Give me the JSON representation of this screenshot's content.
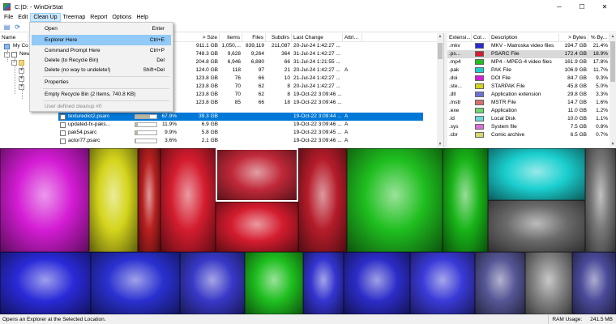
{
  "window": {
    "title": "C:|D: - WinDirStat",
    "minimize": "─",
    "maximize": "☐",
    "close": "✕"
  },
  "menubar": [
    "File",
    "Edit",
    "Clean Up",
    "Treemap",
    "Report",
    "Options",
    "Help"
  ],
  "toolbar": {
    "buttons": [
      "open-icon",
      "refresh-icon"
    ]
  },
  "cleanup_menu": {
    "items": [
      {
        "label": "Open",
        "shortcut": "Enter"
      },
      {
        "label": "Explorer Here",
        "shortcut": "Ctrl+E"
      },
      {
        "label": "Command Prompt Here",
        "shortcut": "Ctrl+P"
      },
      {
        "label": "Delete (to Recycle Bin)",
        "shortcut": "Del"
      },
      {
        "label": "Delete (no way to undelete!)",
        "shortcut": "Shift+Del"
      },
      {
        "label": "Properties",
        "shortcut": ""
      },
      {
        "label": "Empty Recycle Bin (2 Items, 740.8 KB)",
        "shortcut": ""
      },
      {
        "label": "User defined cleanup #0",
        "shortcut": ""
      }
    ]
  },
  "directory_list": {
    "columns": {
      "name": "Name",
      "size": "> Size",
      "items": "Items",
      "files": "Files",
      "subdirs": "Subdirs",
      "last_change": "Last Change",
      "attributes": "Attri..."
    },
    "rows": [
      {
        "name": "My Co",
        "subtree": "",
        "pct": "",
        "size": "911.1 GB",
        "items": "1,050,...",
        "files": "839,119",
        "subdirs": "211,087",
        "last_change": "20-Jul-24 1:42:27 ...",
        "attr": ""
      },
      {
        "name": "New",
        "subtree": "",
        "pct": "",
        "size": "748.3 GB",
        "items": "9,628",
        "files": "9,264",
        "subdirs": "364",
        "last_change": "31-Jul-24 1:42:27 ...",
        "attr": ""
      },
      {
        "name": "",
        "subtree": "",
        "pct": "",
        "size": "204.8 GB",
        "items": "6,946",
        "files": "6,880",
        "subdirs": "66",
        "last_change": "31-Jul-24 1:21:55 ...",
        "attr": ""
      },
      {
        "name": "",
        "subtree": "",
        "pct": "",
        "size": "124.0 GB",
        "items": "118",
        "files": "97",
        "subdirs": "21",
        "last_change": "20-Jul-24 1:42:27 ...",
        "attr": "A"
      },
      {
        "name": "",
        "subtree": "",
        "pct": "",
        "size": "123.8 GB",
        "items": "76",
        "files": "66",
        "subdirs": "10",
        "last_change": "21-Jul-24 1:42:27 ...",
        "attr": ""
      },
      {
        "name": "",
        "subtree": "",
        "pct": "",
        "size": "123.8 GB",
        "items": "70",
        "files": "62",
        "subdirs": "8",
        "last_change": "20-Jul-24 1:42:27 ...",
        "attr": ""
      },
      {
        "name": "",
        "subtree": "",
        "pct": "",
        "size": "123.8 GB",
        "items": "70",
        "files": "62",
        "subdirs": "8",
        "last_change": "19-Oct-22 3:09:46 ...",
        "attr": ""
      },
      {
        "name": "",
        "subtree": "",
        "pct": "",
        "size": "123.8 GB",
        "items": "85",
        "files": "66",
        "subdirs": "18",
        "last_change": "19-Oct-22 3:09:46 ...",
        "attr": ""
      },
      {
        "name": "texturedict2.psarc",
        "subtree": "",
        "pct": "67.9%",
        "size": "39.3 GB",
        "items": "",
        "files": "",
        "subdirs": "",
        "last_change": "19-Oct-22 3:09:44 ...",
        "attr": "A"
      },
      {
        "name": "updated-fx-paks...",
        "subtree": "",
        "pct": "11.9%",
        "size": "6.9 GB",
        "items": "",
        "files": "",
        "subdirs": "",
        "last_change": "19-Oct-22 3:09:46 ...",
        "attr": "A"
      },
      {
        "name": "pak54.psarc",
        "subtree": "",
        "pct": "9.9%",
        "size": "5.8 GB",
        "items": "",
        "files": "",
        "subdirs": "",
        "last_change": "19-Oct-22 3:09:45 ...",
        "attr": "A"
      },
      {
        "name": "actor77.psarc",
        "subtree": "",
        "pct": "3.6%",
        "size": "2.1 GB",
        "items": "",
        "files": "",
        "subdirs": "",
        "last_change": "19-Oct-22 3:09:46 ...",
        "attr": "A"
      }
    ],
    "bar_fill": [
      0.679,
      0.119,
      0.099,
      0.036
    ]
  },
  "extension_list": {
    "columns": {
      "ext": "Extensi...",
      "color": "Col...",
      "description": "Description",
      "bytes": "> Bytes",
      "pct": "% By..."
    },
    "rows": [
      {
        "ext": ".mkv",
        "color": "#2a2ad8",
        "description": "MKV - Matroska video files",
        "bytes": "194.7 GB",
        "pct": "21.4%"
      },
      {
        "ext": ".ps...",
        "color": "#d41c2e",
        "description": "PSARC File",
        "bytes": "172.4 GB",
        "pct": "18.9%"
      },
      {
        "ext": ".mp4",
        "color": "#1fbf1f",
        "description": "MP4 - MPEG-4 video files",
        "bytes": "161.9 GB",
        "pct": "17.8%"
      },
      {
        "ext": ".pak",
        "color": "#1bcfcf",
        "description": "PAK File",
        "bytes": "106.9 GB",
        "pct": "11.7%"
      },
      {
        "ext": ".doi",
        "color": "#d41cd4",
        "description": "DOI File",
        "bytes": "84.7 GB",
        "pct": "9.3%"
      },
      {
        "ext": ".ste...",
        "color": "#d4d41c",
        "description": "STARPAK File",
        "bytes": "45.8 GB",
        "pct": "5.0%"
      },
      {
        "ext": ".dll",
        "color": "#6f6fd8",
        "description": "Application extension",
        "bytes": "29.8 GB",
        "pct": "3.3%"
      },
      {
        "ext": ".mstr",
        "color": "#d86f6f",
        "description": "MSTR File",
        "bytes": "14.7 GB",
        "pct": "1.6%"
      },
      {
        "ext": ".exe",
        "color": "#6fd86f",
        "description": "Application",
        "bytes": "11.0 GB",
        "pct": "1.2%"
      },
      {
        "ext": ".ld",
        "color": "#6fd8d8",
        "description": "Local Disk",
        "bytes": "10.0 GB",
        "pct": "1.1%"
      },
      {
        "ext": ".sys",
        "color": "#d86fd8",
        "description": "System file",
        "bytes": "7.5 GB",
        "pct": "0.8%"
      },
      {
        "ext": ".cbr",
        "color": "#d8d86f",
        "description": "Comic archive",
        "bytes": "6.5 GB",
        "pct": "0.7%"
      }
    ]
  },
  "statusbar": {
    "message": "Opens an Explorer at the Selected Location.",
    "ram_label": "RAM Usage:",
    "ram_value": "241.5 MB"
  }
}
